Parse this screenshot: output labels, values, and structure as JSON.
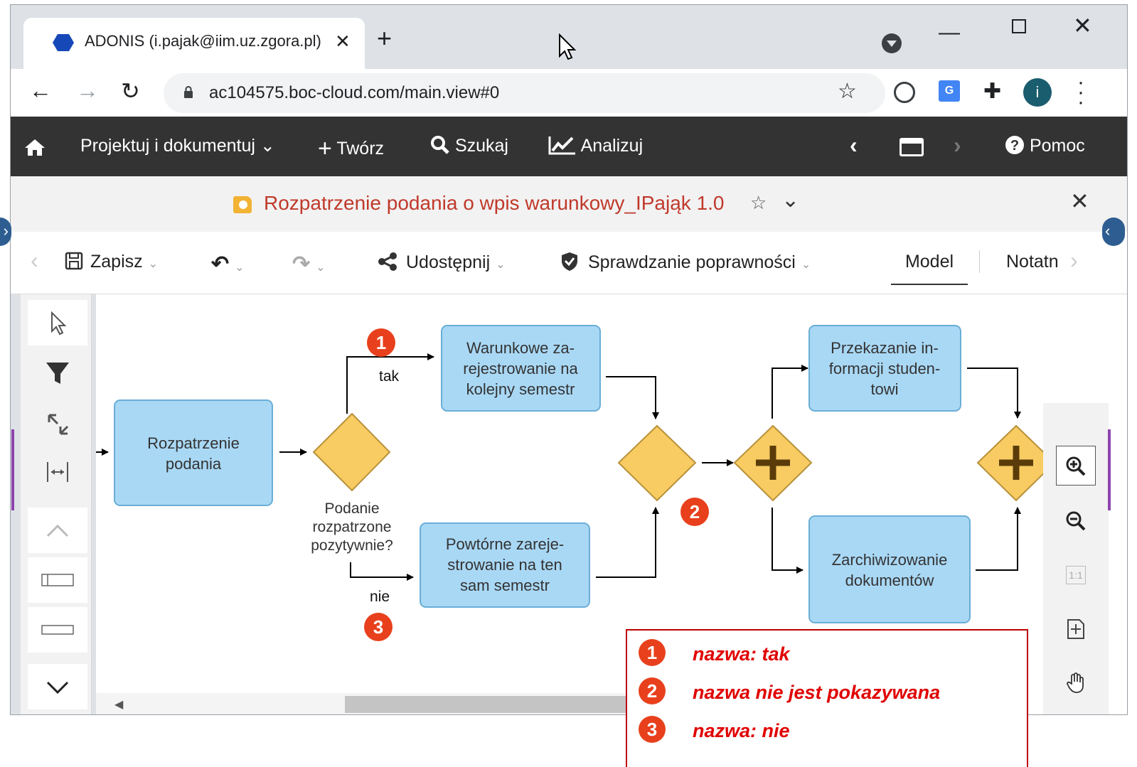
{
  "browser": {
    "tab_title": "ADONIS (i.pajak@iim.uz.zgora.pl)",
    "tab_close": "✕",
    "new_tab": "+",
    "minimize": "—",
    "close_window": "✕",
    "url": "ac104575.boc-cloud.com/main.view#0",
    "star": "☆",
    "profile_initial": "i",
    "translate_badge": "G"
  },
  "appnav": {
    "design": "Projektuj i dokumentuj",
    "create": "Twórz",
    "search": "Szukaj",
    "analyze": "Analizuj",
    "help": "Pomoc"
  },
  "model": {
    "title": "Rozpatrzenie podania o wpis warunkowy_IPająk 1.0",
    "fav": "☆"
  },
  "editor_toolbar": {
    "save": "Zapisz",
    "share": "Udostępnij",
    "validate": "Sprawdzanie poprawności",
    "model_tab": "Model",
    "notes_tab": "Notatn"
  },
  "diagram": {
    "tasks": {
      "review": [
        "Rozpatrzenie",
        "podania"
      ],
      "conditional": [
        "Warunkowe za-",
        "rejestrowanie na",
        "kolejny semestr"
      ],
      "repeat": [
        "Powtórne zareje-",
        "strowanie na ten",
        "sam semestr"
      ],
      "inform": [
        "Przekazanie in-",
        "formacji studen-",
        "towi"
      ],
      "archive": [
        "Zarchiwizowanie",
        "dokumentów"
      ]
    },
    "gateway_label": [
      "Podanie",
      "rozpatrzone",
      "pozytywnie?"
    ],
    "edge_yes": "tak",
    "edge_no": "nie"
  },
  "zoom": {
    "actual_size": "1:1"
  },
  "annotations": {
    "badges": [
      "1",
      "2",
      "3"
    ],
    "legend": [
      {
        "num": "1",
        "text": "nazwa: tak"
      },
      {
        "num": "2",
        "text": "nazwa nie jest pokazywana"
      },
      {
        "num": "3",
        "text": "nazwa: nie"
      }
    ]
  },
  "colors": {
    "task_fill": "#a9d8f5",
    "task_stroke": "#6aaed6",
    "gateway_fill": "#f8cc62",
    "gateway_stroke": "#b8913a",
    "annotation": "#e8401c",
    "legend_text": "#e00000",
    "app_nav": "#333333",
    "model_title": "#c0392b"
  },
  "icons": [
    "home-icon",
    "plus-icon",
    "search-icon",
    "chart-icon",
    "help-icon",
    "save-icon",
    "undo-icon",
    "redo-icon",
    "share-icon",
    "shield-icon",
    "pointer-icon",
    "filter-icon",
    "connect-icon",
    "fit-width-icon",
    "zoom-in-icon",
    "zoom-out-icon",
    "fit-page-icon",
    "hand-icon"
  ]
}
